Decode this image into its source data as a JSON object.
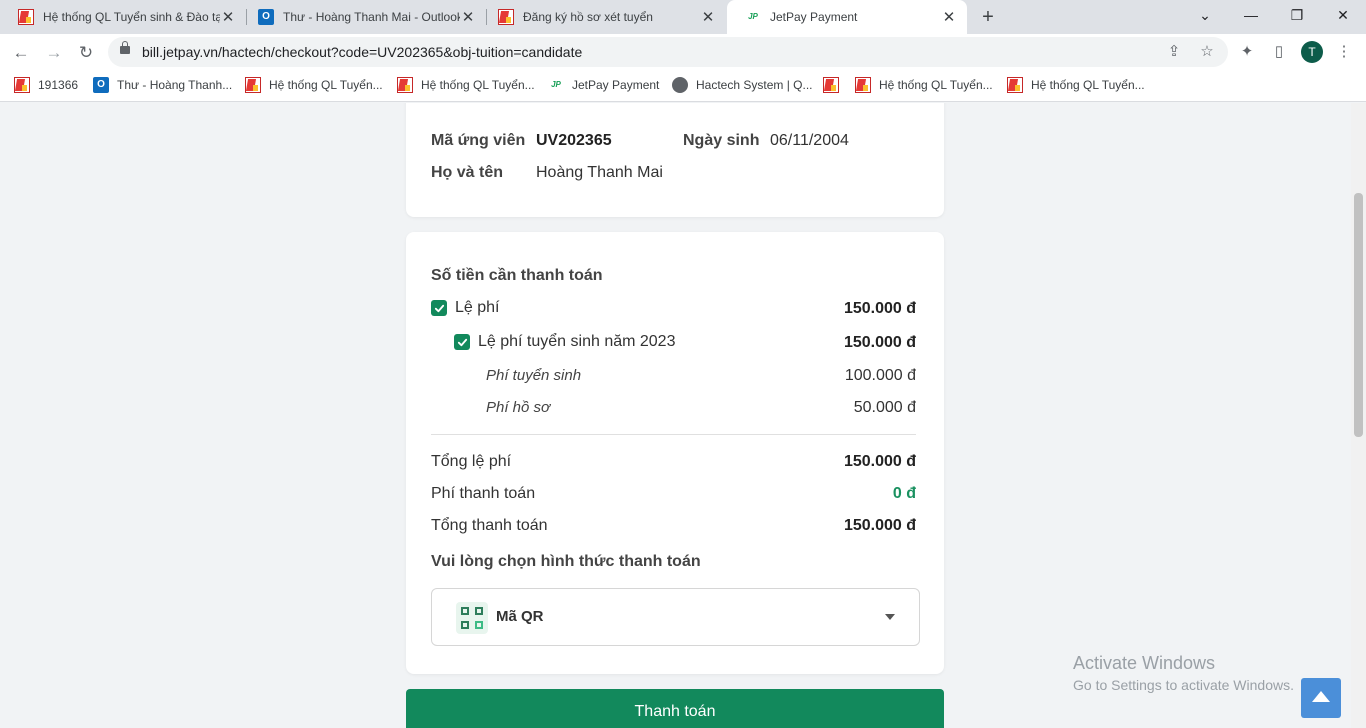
{
  "browser": {
    "tabs": [
      {
        "title": "Hệ thống QL Tuyển sinh & Đào tạo",
        "icon": "red-logo-icon"
      },
      {
        "title": "Thư - Hoàng Thanh Mai - Outlook",
        "icon": "outlook-icon"
      },
      {
        "title": "Đăng ký hồ sơ xét tuyển",
        "icon": "red-logo-icon"
      },
      {
        "title": "JetPay Payment",
        "icon": "jetpay-icon",
        "active": true
      }
    ],
    "url": "bill.jetpay.vn/hactech/checkout?code=UV202365&obj-tuition=candidate",
    "profile_initial": "T",
    "bookmarks": [
      {
        "label": "191366",
        "icon": "red-logo-icon"
      },
      {
        "label": "Thư - Hoàng Thanh...",
        "icon": "outlook-icon"
      },
      {
        "label": "Hệ thống QL Tuyển...",
        "icon": "red-logo-icon"
      },
      {
        "label": "Hệ thống QL Tuyển...",
        "icon": "red-logo-icon"
      },
      {
        "label": "JetPay Payment",
        "icon": "jetpay-icon"
      },
      {
        "label": "Hactech System | Q...",
        "icon": "globe-icon"
      },
      {
        "label": "",
        "icon": "red-logo-icon"
      },
      {
        "label": "Hệ thống QL Tuyển...",
        "icon": "red-logo-icon"
      },
      {
        "label": "Hệ thống QL Tuyển...",
        "icon": "red-logo-icon"
      }
    ]
  },
  "candidate": {
    "code_label": "Mã ứng viên",
    "code_value": "UV202365",
    "dob_label": "Ngày sinh",
    "dob_value": "06/11/2004",
    "name_label": "Họ và tên",
    "name_value": "Hoàng Thanh Mai"
  },
  "payment": {
    "section_title": "Số tiền cần thanh toán",
    "fee_group": {
      "label": "Lệ phí",
      "amount": "150.000 đ",
      "checked": true
    },
    "fee_item": {
      "label": "Lệ phí tuyển sinh năm 2023",
      "amount": "150.000 đ",
      "checked": true
    },
    "sub_items": [
      {
        "label": "Phí tuyển sinh",
        "amount": "100.000 đ"
      },
      {
        "label": "Phí hồ sơ",
        "amount": "50.000 đ"
      }
    ],
    "total_fee_label": "Tổng lệ phí",
    "total_fee": "150.000 đ",
    "transaction_fee_label": "Phí thanh toán",
    "transaction_fee": "0 đ",
    "grand_total_label": "Tổng thanh toán",
    "grand_total": "150.000 đ",
    "method_prompt": "Vui lòng chọn hình thức thanh toán",
    "method_selected": "Mã QR",
    "pay_button": "Thanh toán"
  },
  "watermark": {
    "line1": "Activate Windows",
    "line2": "Go to Settings to activate Windows."
  },
  "colors": {
    "accent": "#12895c",
    "zero_fee": "#1a9160",
    "page_bg": "#f1f3f5"
  }
}
